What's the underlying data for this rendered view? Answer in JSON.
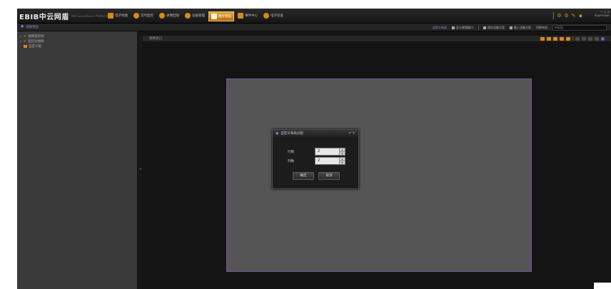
{
  "app": {
    "logo": "EBIB中云网盾",
    "logo_subtitle": "Net Surveillance Platform",
    "menu": [
      {
        "label": "电子地图",
        "icon": "map-icon"
      },
      {
        "label": "实时监控",
        "icon": "camera-icon"
      },
      {
        "label": "录像回放",
        "icon": "playback-icon"
      },
      {
        "label": "设备管理",
        "icon": "device-icon"
      },
      {
        "label": "图片预览",
        "icon": "picture-icon",
        "active": true
      },
      {
        "label": "事件中心",
        "icon": "event-icon"
      },
      {
        "label": "电子巡查",
        "icon": "patrol-icon"
      }
    ],
    "window_controls": "— ☐ ✕",
    "window_user": "Supervisor",
    "accent_color": "#d8891c"
  },
  "subbar": {
    "title": "视频预览",
    "layout_link": "自定义布局",
    "tools": [
      "显示视频窗口",
      "保存设备方案",
      "载入设备方案",
      "切换布局"
    ],
    "select_value": "布局组"
  },
  "tree": {
    "items": [
      {
        "label": "视频监控树",
        "expand": "▸",
        "check": "✔"
      },
      {
        "label": "监控分组组",
        "expand": "▸",
        "check": "✔"
      },
      {
        "label": "自定义组",
        "expand": "",
        "check": ""
      }
    ]
  },
  "main": {
    "title": "图像窗口",
    "splitter_glyph": "◂"
  },
  "dialog": {
    "title": "自定义布局分割",
    "close": "✔✕",
    "rows_label": "行数",
    "rows_value": "2",
    "cols_label": "列数",
    "cols_value": "2",
    "ok_label": "确定",
    "cancel_label": "取消"
  }
}
